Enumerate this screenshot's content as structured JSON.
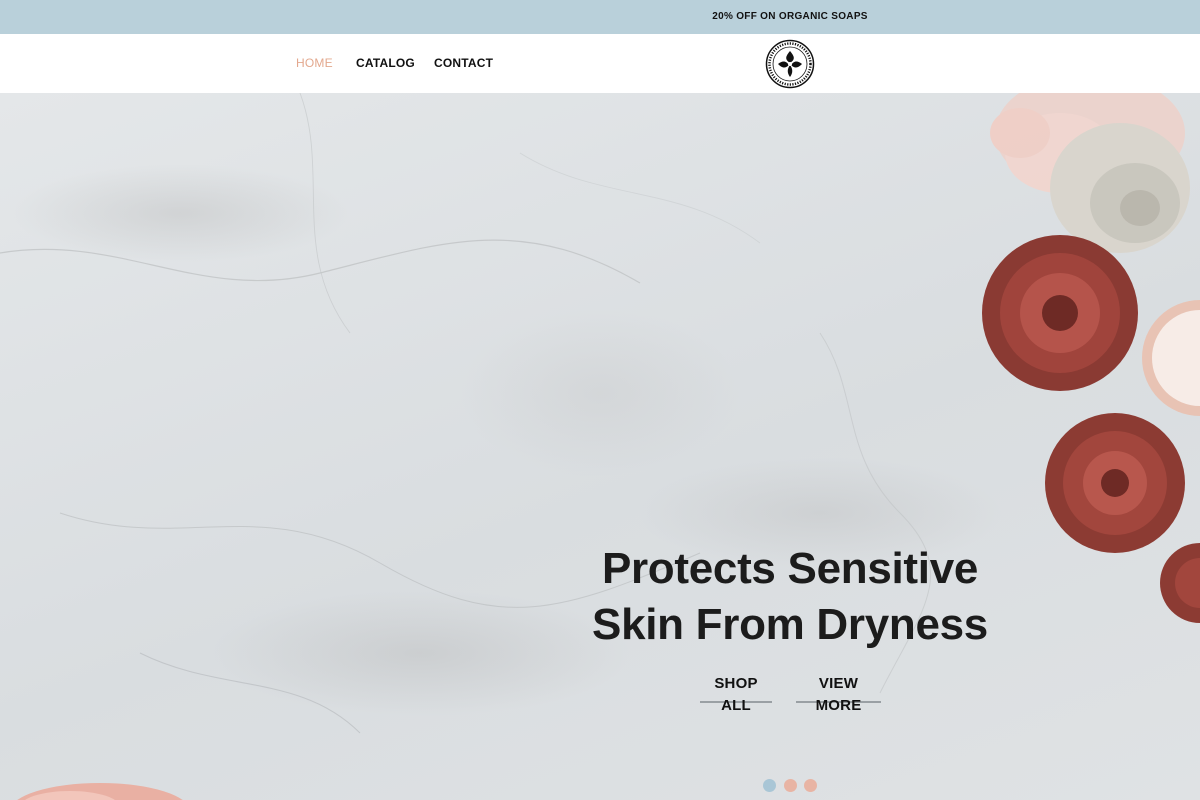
{
  "announcement": {
    "text": "20% OFF ON ORGANIC SOAPS"
  },
  "nav": {
    "items": [
      {
        "label": "HOME",
        "active": true
      },
      {
        "label": "CATALOG",
        "active": false
      },
      {
        "label": "CONTACT",
        "active": false
      }
    ],
    "logo_icon": "company-seal-logo"
  },
  "hero": {
    "headline_line1": "Protects Sensitive",
    "headline_line2": "Skin From Dryness",
    "shop_all_label": "SHOP ALL",
    "view_more_label": "VIEW MORE",
    "slides": {
      "count": 3,
      "active": 1
    }
  },
  "colors": {
    "announcement_bg": "#b9d0da",
    "nav_active": "#e3a88e",
    "dot_active": "#a9c6d6",
    "dot_inactive": "#e8b4a4"
  }
}
